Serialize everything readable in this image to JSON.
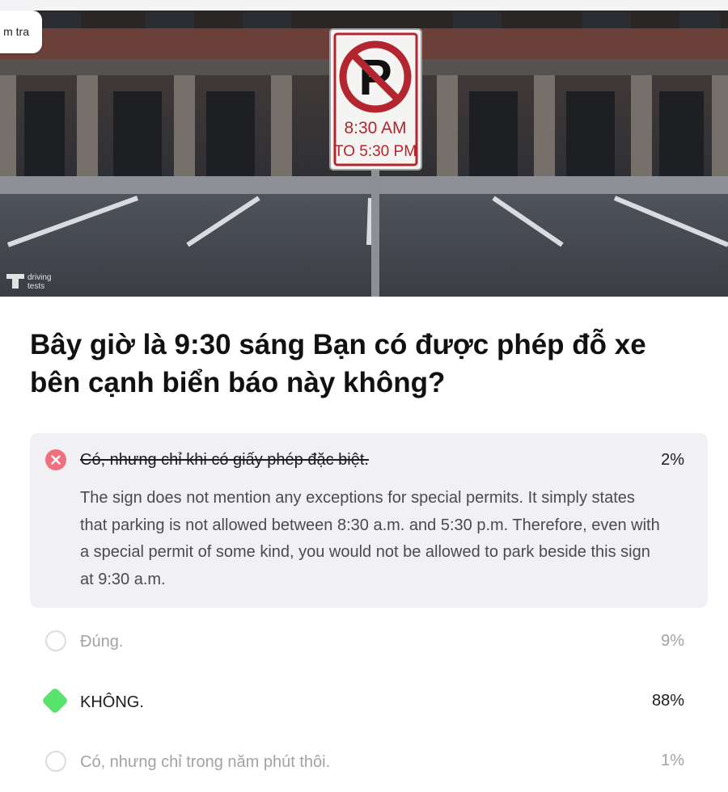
{
  "header": {
    "back_label": "m tra"
  },
  "image": {
    "sign_line1": "8:30 AM",
    "sign_line2": "TO 5:30 PM",
    "watermark_line1": "driving",
    "watermark_line2": "tests"
  },
  "question": "Bây giờ là 9:30 sáng Bạn có được phép đỗ xe bên cạnh biển báo này không?",
  "answers": [
    {
      "label": "Có, nhưng chỉ khi có giấy phép đặc biệt.",
      "percent": "2%",
      "state": "wrong",
      "explanation": "The sign does not mention any exceptions for special permits. It simply states that parking is not allowed between 8:30 a.m. and 5:30 p.m. Therefore, even with a special permit of some kind, you would not be allowed to park beside this sign at 9:30 a.m."
    },
    {
      "label": "Đúng.",
      "percent": "9%",
      "state": "neutral"
    },
    {
      "label": "KHÔNG.",
      "percent": "88%",
      "state": "correct"
    },
    {
      "label": "Có, nhưng chỉ trong năm phút thôi.",
      "percent": "1%",
      "state": "neutral"
    }
  ],
  "colors": {
    "wrong": "#ef6f7c",
    "correct": "#58e36a",
    "panel": "#f1f1f5"
  },
  "icons": [
    "x-circle-icon",
    "radio-circle-icon",
    "correct-diamond-icon",
    "no-parking-icon",
    "drivingtests-logo-icon"
  ]
}
